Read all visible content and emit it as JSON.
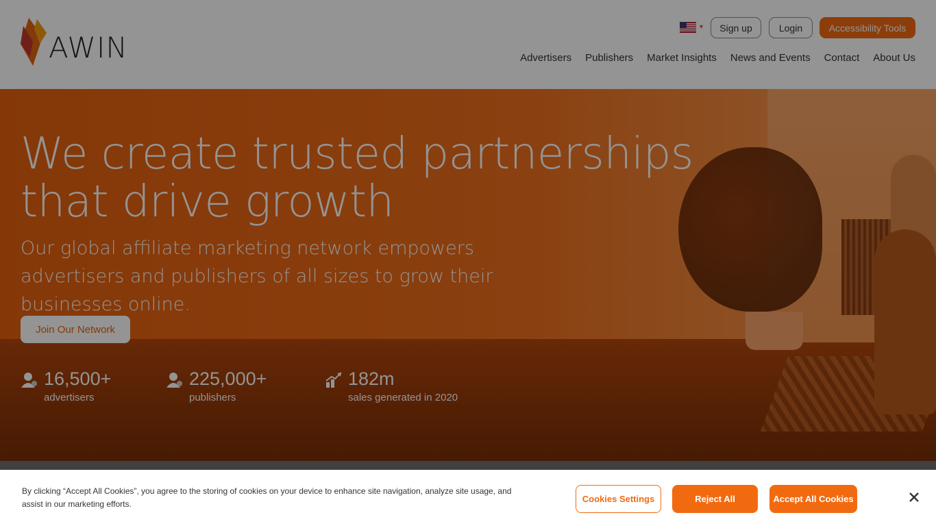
{
  "header": {
    "logo_text": "AWIN",
    "signup_label": "Sign up",
    "login_label": "Login",
    "accessibility_label": "Accessibility Tools",
    "nav": [
      "Advertisers",
      "Publishers",
      "Market Insights",
      "News and Events",
      "Contact",
      "About Us"
    ]
  },
  "hero": {
    "title": "We create trusted partnerships that drive growth",
    "subtitle": "Our global affiliate marketing network empowers advertisers and publishers of all sizes to grow their businesses online.",
    "cta_label": "Join Our Network",
    "stats": [
      {
        "value": "16,500+",
        "label": "advertisers",
        "icon": "advertiser-icon"
      },
      {
        "value": "225,000+",
        "label": "publishers",
        "icon": "publisher-icon"
      },
      {
        "value": "182m",
        "label": "sales generated in 2020",
        "icon": "growth-chart-icon"
      }
    ]
  },
  "cookie_banner": {
    "text": "By clicking “Accept All Cookies”, you agree to the storing of cookies on your device to enhance site navigation, analyze site usage, and assist in our marketing efforts.",
    "settings_label": "Cookies Settings",
    "reject_label": "Reject All",
    "accept_label": "Accept All Cookies",
    "close_icon": "close-icon"
  },
  "colors": {
    "brand_orange": "#f26a10",
    "text_dark": "#333333"
  }
}
